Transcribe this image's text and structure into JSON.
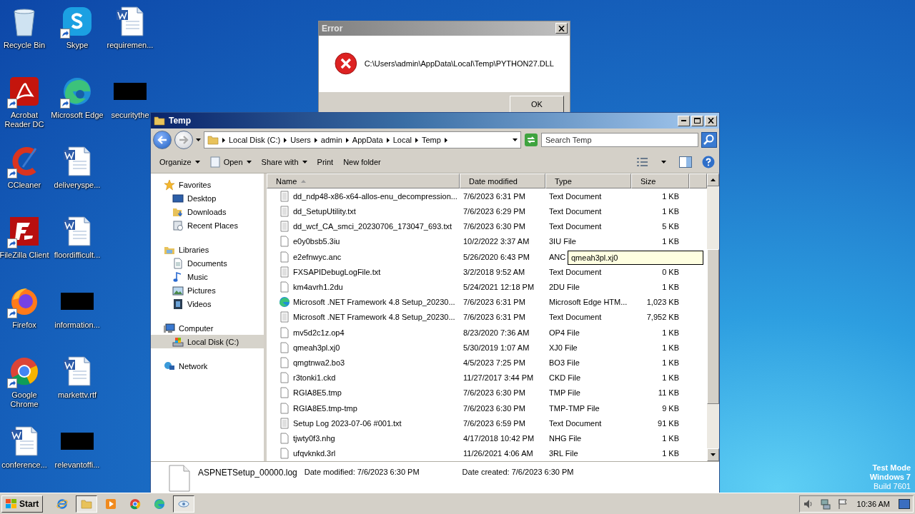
{
  "desktop_icons": [
    {
      "label": "Recycle Bin",
      "kind": "recycle",
      "shortcut": false
    },
    {
      "label": "Acrobat Reader DC",
      "kind": "acrobat",
      "shortcut": true
    },
    {
      "label": "CCleaner",
      "kind": "ccleaner",
      "shortcut": true
    },
    {
      "label": "FileZilla Client",
      "kind": "filezilla",
      "shortcut": true
    },
    {
      "label": "Firefox",
      "kind": "firefox",
      "shortcut": true
    },
    {
      "label": "Google Chrome",
      "kind": "chrome",
      "shortcut": true
    },
    {
      "label": "conference...",
      "kind": "word",
      "shortcut": false
    },
    {
      "label": "Skype",
      "kind": "skype",
      "shortcut": true
    },
    {
      "label": "Microsoft Edge",
      "kind": "edge",
      "shortcut": true
    },
    {
      "label": "deliveryspe...",
      "kind": "word",
      "shortcut": false
    },
    {
      "label": "floordifficult...",
      "kind": "word",
      "shortcut": false
    },
    {
      "label": "information...",
      "kind": "thumbnail",
      "shortcut": false
    },
    {
      "label": "markettv.rtf",
      "kind": "word",
      "shortcut": false
    },
    {
      "label": "relevantoffi...",
      "kind": "thumbnail",
      "shortcut": false
    },
    {
      "label": "requiremen...",
      "kind": "word",
      "shortcut": false
    },
    {
      "label": "securitythe",
      "kind": "thumbnail",
      "shortcut": false
    }
  ],
  "error_dialog": {
    "title": "Error",
    "message": "C:\\Users\\admin\\AppData\\Local\\Temp\\PYTHON27.DLL",
    "button": "OK"
  },
  "explorer": {
    "title": "Temp",
    "breadcrumbs": [
      "Local Disk (C:)",
      "Users",
      "admin",
      "AppData",
      "Local",
      "Temp"
    ],
    "search": {
      "placeholder": "Search Temp"
    },
    "toolbar": [
      {
        "label": "Organize",
        "kind": "menu"
      },
      {
        "label": "Open",
        "kind": "app"
      },
      {
        "label": "Share with",
        "kind": "menu"
      },
      {
        "label": "Print",
        "kind": "command"
      },
      {
        "label": "New folder",
        "kind": "command"
      }
    ],
    "sidebar": [
      {
        "label": "Favorites",
        "kind": "star",
        "selected": false,
        "children": [
          {
            "label": "Desktop",
            "kind": "desktop",
            "selected": false
          },
          {
            "label": "Downloads",
            "kind": "downloads",
            "selected": false
          },
          {
            "label": "Recent Places",
            "kind": "recent",
            "selected": false
          }
        ]
      },
      {
        "label": "Libraries",
        "kind": "libraries",
        "selected": false,
        "children": [
          {
            "label": "Documents",
            "kind": "documents",
            "selected": false
          },
          {
            "label": "Music",
            "kind": "music",
            "selected": false
          },
          {
            "label": "Pictures",
            "kind": "pictures",
            "selected": false
          },
          {
            "label": "Videos",
            "kind": "videos",
            "selected": false
          }
        ]
      },
      {
        "label": "Computer",
        "kind": "computer",
        "selected": false,
        "children": [
          {
            "label": "Local Disk (C:)",
            "kind": "disk",
            "selected": true
          }
        ]
      },
      {
        "label": "Network",
        "kind": "network",
        "selected": false
      }
    ],
    "columns": [
      {
        "label": "Name",
        "sorted": true
      },
      {
        "label": "Date modified",
        "sorted": false
      },
      {
        "label": "Type",
        "sorted": false
      },
      {
        "label": "Size",
        "sorted": false
      }
    ],
    "rows": [
      {
        "name": "dd_ndp48-x86-x64-allos-enu_decompression...",
        "date": "7/6/2023 6:31 PM",
        "type": "Text Document",
        "size": "1 KB",
        "kind": "text"
      },
      {
        "name": "dd_SetupUtility.txt",
        "date": "7/6/2023 6:29 PM",
        "type": "Text Document",
        "size": "1 KB",
        "kind": "text"
      },
      {
        "name": "dd_wcf_CA_smci_20230706_173047_693.txt",
        "date": "7/6/2023 6:30 PM",
        "type": "Text Document",
        "size": "5 KB",
        "kind": "text"
      },
      {
        "name": "e0y0bsb5.3iu",
        "date": "10/2/2022 3:37 AM",
        "type": "3IU File",
        "size": "1 KB",
        "kind": "file"
      },
      {
        "name": "e2efnwyc.anc",
        "date": "5/26/2020 6:43 PM",
        "type": "ANC",
        "kind": "file"
      },
      {
        "name": "FXSAPIDebugLogFile.txt",
        "date": "3/2/2018 9:52 AM",
        "type": "Text Document",
        "size": "0 KB",
        "kind": "text"
      },
      {
        "name": "km4avrh1.2du",
        "date": "5/24/2021 12:18 PM",
        "type": "2DU File",
        "size": "1 KB",
        "kind": "file"
      },
      {
        "name": "Microsoft .NET Framework 4.8 Setup_20230...",
        "date": "7/6/2023 6:31 PM",
        "type": "Microsoft Edge HTM...",
        "size": "1,023 KB",
        "kind": "edge"
      },
      {
        "name": "Microsoft .NET Framework 4.8 Setup_20230...",
        "date": "7/6/2023 6:31 PM",
        "type": "Text Document",
        "size": "7,952 KB",
        "kind": "text"
      },
      {
        "name": "mv5d2c1z.op4",
        "date": "8/23/2020 7:36 AM",
        "type": "OP4 File",
        "size": "1 KB",
        "kind": "file"
      },
      {
        "name": "qmeah3pl.xj0",
        "date": "5/30/2019 1:07 AM",
        "type": "XJ0 File",
        "size": "1 KB",
        "kind": "file"
      },
      {
        "name": "qmgtnwa2.bo3",
        "date": "4/5/2023 7:25 PM",
        "type": "BO3 File",
        "size": "1 KB",
        "kind": "file"
      },
      {
        "name": "r3tonki1.ckd",
        "date": "11/27/2017 3:44 PM",
        "type": "CKD File",
        "size": "1 KB",
        "kind": "file"
      },
      {
        "name": "RGIA8E5.tmp",
        "date": "7/6/2023 6:30 PM",
        "type": "TMP File",
        "size": "11 KB",
        "kind": "file"
      },
      {
        "name": "RGIA8E5.tmp-tmp",
        "date": "7/6/2023 6:30 PM",
        "type": "TMP-TMP File",
        "size": "9 KB",
        "kind": "file"
      },
      {
        "name": "Setup Log 2023-07-06 #001.txt",
        "date": "7/6/2023 6:59 PM",
        "type": "Text Document",
        "size": "91 KB",
        "kind": "text"
      },
      {
        "name": "tjwty0f3.nhg",
        "date": "4/17/2018 10:42 PM",
        "type": "NHG File",
        "size": "1 KB",
        "kind": "file"
      },
      {
        "name": "ufqvknkd.3rl",
        "date": "11/26/2021 4:06 AM",
        "type": "3RL File",
        "size": "1 KB",
        "kind": "file"
      }
    ],
    "tooltip": "qmeah3pl.xj0",
    "details": {
      "name": "ASPNETSetup_00000.log",
      "modified": "Date modified: 7/6/2023 6:30 PM",
      "created": "Date created: 7/6/2023 6:30 PM"
    }
  },
  "os_notice": [
    "Test Mode",
    "Windows 7",
    "Build 7601"
  ],
  "taskbar": {
    "start": "Start",
    "items": [
      {
        "kind": "ie",
        "active": false
      },
      {
        "kind": "explorer",
        "active": true
      },
      {
        "kind": "media",
        "active": false
      },
      {
        "kind": "chrome",
        "active": false
      },
      {
        "kind": "edge",
        "active": false
      },
      {
        "kind": "app",
        "active": true
      }
    ],
    "clock": "10:36 AM"
  }
}
